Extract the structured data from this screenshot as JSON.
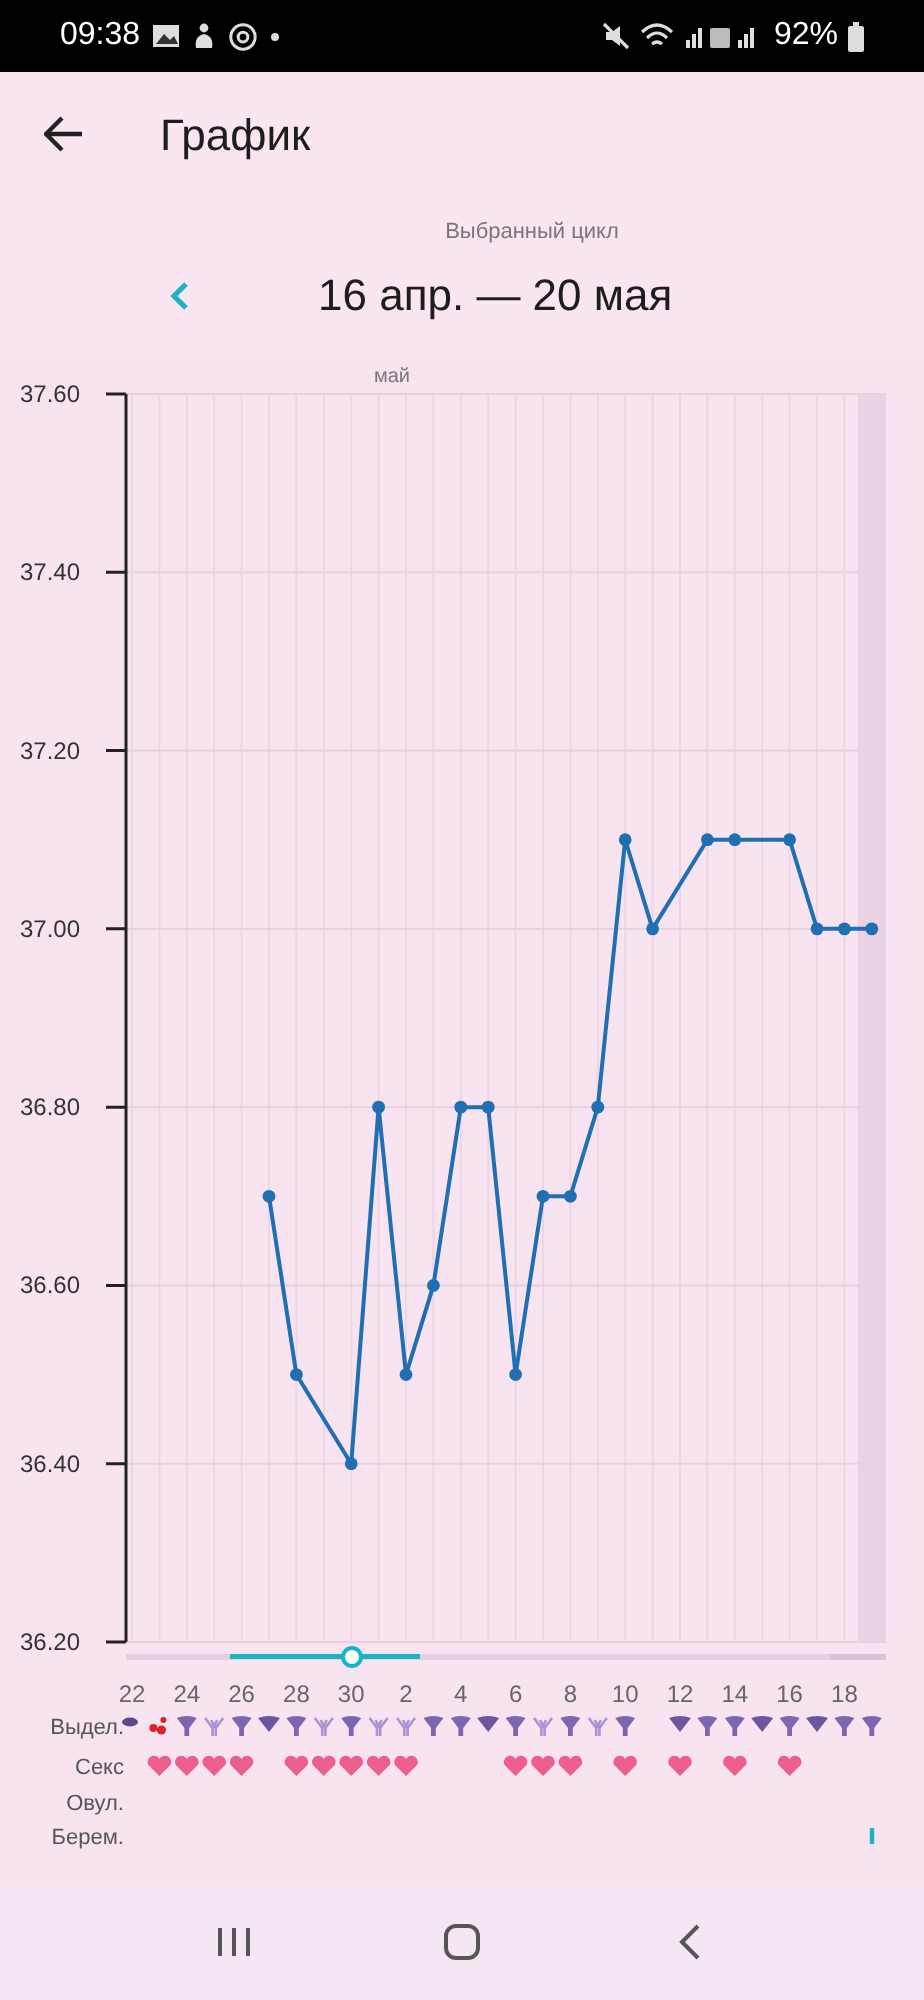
{
  "status_bar": {
    "time": "09:38",
    "battery": "92%"
  },
  "header": {
    "title": "График"
  },
  "cycle": {
    "caption": "Выбранный цикл",
    "range": "16 апр. — 20 мая"
  },
  "chart": {
    "month_label": "май",
    "chart_data": {
      "type": "line",
      "grid": true,
      "categories": [
        "22",
        null,
        "24",
        null,
        "26",
        null,
        "28",
        null,
        "30",
        null,
        "2",
        null,
        "4",
        null,
        "6",
        null,
        "8",
        null,
        "10",
        null,
        "12",
        null,
        "14",
        null,
        "16",
        null,
        "18",
        null
      ],
      "series": [
        {
          "color": "#1f6fb2",
          "marker": "circle",
          "values": [
            null,
            null,
            null,
            null,
            null,
            36.7,
            36.5,
            null,
            36.4,
            36.8,
            36.5,
            36.6,
            36.8,
            36.8,
            36.5,
            36.7,
            36.7,
            36.8,
            37.1,
            37.0,
            null,
            37.1,
            37.1,
            null,
            37.1,
            37.0,
            37.0,
            37.0
          ]
        }
      ],
      "ylim": [
        36.2,
        37.6
      ],
      "yticks": [
        {
          "value": 36.2,
          "label": "36.20"
        },
        {
          "value": 36.4,
          "label": "36.40"
        },
        {
          "value": 36.6,
          "label": "36.60"
        },
        {
          "value": 36.8,
          "label": "36.80"
        },
        {
          "value": 37.0,
          "label": "37.00"
        },
        {
          "value": 37.2,
          "label": "37.20"
        },
        {
          "value": 37.4,
          "label": "37.40"
        },
        {
          "value": 37.6,
          "label": "37.60"
        }
      ]
    }
  },
  "rows": [
    {
      "label": "Выдел.",
      "marks": [
        {
          "kind": "spotting"
        },
        {
          "kind": "blood"
        },
        {
          "kind": "medium"
        },
        {
          "kind": "light"
        },
        {
          "kind": "medium"
        },
        {
          "kind": "heavy"
        },
        {
          "kind": "medium"
        },
        {
          "kind": "light"
        },
        {
          "kind": "medium"
        },
        {
          "kind": "light"
        },
        {
          "kind": "light"
        },
        {
          "kind": "medium"
        },
        {
          "kind": "medium"
        },
        {
          "kind": "heavy"
        },
        {
          "kind": "medium"
        },
        {
          "kind": "light"
        },
        {
          "kind": "medium"
        },
        {
          "kind": "light"
        },
        {
          "kind": "medium"
        },
        {
          "kind": "none"
        },
        {
          "kind": "heavy"
        },
        {
          "kind": "medium"
        },
        {
          "kind": "medium"
        },
        {
          "kind": "heavy"
        },
        {
          "kind": "medium"
        },
        {
          "kind": "heavy"
        },
        {
          "kind": "medium"
        },
        {
          "kind": "medium"
        }
      ]
    },
    {
      "label": "Секс",
      "marks": [
        {
          "kind": "none"
        },
        {
          "kind": "heart"
        },
        {
          "kind": "heart"
        },
        {
          "kind": "heart"
        },
        {
          "kind": "heart"
        },
        {
          "kind": "none"
        },
        {
          "kind": "heart"
        },
        {
          "kind": "heart"
        },
        {
          "kind": "heart"
        },
        {
          "kind": "heart"
        },
        {
          "kind": "heart"
        },
        {
          "kind": "none"
        },
        {
          "kind": "none"
        },
        {
          "kind": "none"
        },
        {
          "kind": "heart"
        },
        {
          "kind": "heart"
        },
        {
          "kind": "heart"
        },
        {
          "kind": "none"
        },
        {
          "kind": "heart"
        },
        {
          "kind": "none"
        },
        {
          "kind": "heart"
        },
        {
          "kind": "none"
        },
        {
          "kind": "heart"
        },
        {
          "kind": "none"
        },
        {
          "kind": "heart"
        },
        {
          "kind": "none"
        },
        {
          "kind": "none"
        },
        {
          "kind": "none"
        }
      ]
    },
    {
      "label": "Овул."
    },
    {
      "label": "Берем.",
      "marks": [
        {
          "kind": "none"
        },
        {
          "kind": "none"
        },
        {
          "kind": "none"
        },
        {
          "kind": "none"
        },
        {
          "kind": "none"
        },
        {
          "kind": "none"
        },
        {
          "kind": "none"
        },
        {
          "kind": "none"
        },
        {
          "kind": "none"
        },
        {
          "kind": "none"
        },
        {
          "kind": "none"
        },
        {
          "kind": "none"
        },
        {
          "kind": "none"
        },
        {
          "kind": "none"
        },
        {
          "kind": "none"
        },
        {
          "kind": "none"
        },
        {
          "kind": "none"
        },
        {
          "kind": "none"
        },
        {
          "kind": "none"
        },
        {
          "kind": "none"
        },
        {
          "kind": "none"
        },
        {
          "kind": "none"
        },
        {
          "kind": "none"
        },
        {
          "kind": "none"
        },
        {
          "kind": "none"
        },
        {
          "kind": "none"
        },
        {
          "kind": "none"
        },
        {
          "kind": "pregnancy"
        }
      ]
    }
  ]
}
